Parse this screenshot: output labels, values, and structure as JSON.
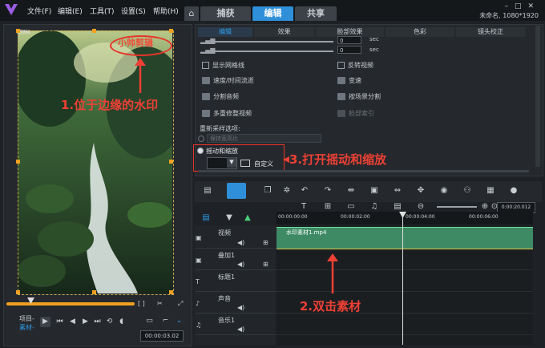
{
  "menu": [
    "文件(F)",
    "编辑(E)",
    "工具(T)",
    "设置(S)",
    "帮助(H)"
  ],
  "mode_tabs": [
    "捕获",
    "编辑",
    "共享"
  ],
  "project_info": "未命名, 1080*1920",
  "player": {
    "watermark_corner": "视频标",
    "watermark_text": "小帅剪辑",
    "annotation": "1.位于边缘的水印",
    "project_label": "项目-",
    "clip_label": "素材-",
    "timecode": "00:00:03.02"
  },
  "options": {
    "tabs": [
      "编辑",
      "效果",
      "脸部效果",
      "色彩",
      "镜头校正"
    ],
    "sec_label": "sec",
    "spin1": "0",
    "spin2": "0",
    "show_grid": "显示网格线",
    "reverse": "反转视频",
    "speed_time": "速度/时间流逝",
    "variable_speed": "变速",
    "split_audio": "分割音频",
    "split_by_scene": "按场景分割",
    "multi_trim": "多重修整视频",
    "face_index": "脸部索引",
    "resample_label": "重新采样选项:",
    "resample_value": "保持宽高比",
    "pan_zoom": "摇动和缩放",
    "custom": "自定义",
    "annotation": "3.打开摇动和缩放"
  },
  "ruler": {
    "labels": [
      "00:00:00:00",
      "00:00:02:00",
      "00:00:04:00",
      "00:00:06:00"
    ],
    "timecode": "0:00:20.012"
  },
  "tracks": [
    {
      "name": "视频"
    },
    {
      "name": "叠加1"
    },
    {
      "name": "标题1"
    },
    {
      "name": "声音"
    },
    {
      "name": "音乐1"
    }
  ],
  "clip": {
    "name": "水印素材1.mp4"
  },
  "timeline_annotation": "2.双击素材",
  "colors": {
    "accent": "#2f8fd8",
    "annotation": "#ee4035",
    "clip": "#3e8a65"
  }
}
